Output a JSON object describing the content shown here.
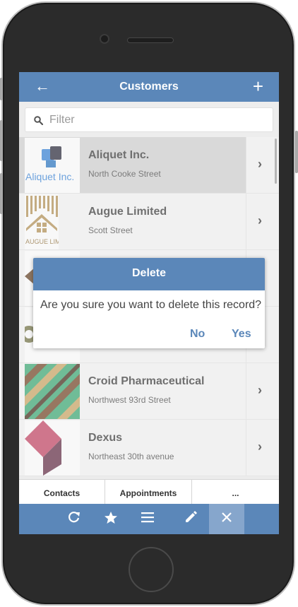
{
  "header": {
    "title": "Customers",
    "back_icon": "arrow-left-icon",
    "add_icon": "plus-icon"
  },
  "filter": {
    "placeholder": "Filter",
    "value": ""
  },
  "customers": [
    {
      "name": "Aliquet Inc.",
      "street": "North Cooke Street",
      "logo_text": "Aliquet Inc.",
      "selected": true
    },
    {
      "name": "Augue Limited",
      "street": "Scott Street",
      "logo_text": "AUGUE LIMITED"
    },
    {
      "name": "",
      "street": ""
    },
    {
      "name": "",
      "street": ""
    },
    {
      "name": "Croid Pharmaceutical",
      "street": "Northwest 93rd Street"
    },
    {
      "name": "Dexus",
      "street": "Northeast 30th avenue"
    }
  ],
  "dialog": {
    "title": "Delete",
    "message": "Are you sure you want to delete this record?",
    "no_label": "No",
    "yes_label": "Yes"
  },
  "tabs": [
    {
      "label": "Contacts"
    },
    {
      "label": "Appointments"
    },
    {
      "label": "..."
    }
  ],
  "toolbar": {
    "icons": [
      "refresh-icon",
      "star-icon",
      "menu-icon",
      "edit-icon",
      "close-icon"
    ],
    "active": "close-icon"
  },
  "colors": {
    "accent": "#5b87b9",
    "selected_row": "#cfcfcf"
  }
}
